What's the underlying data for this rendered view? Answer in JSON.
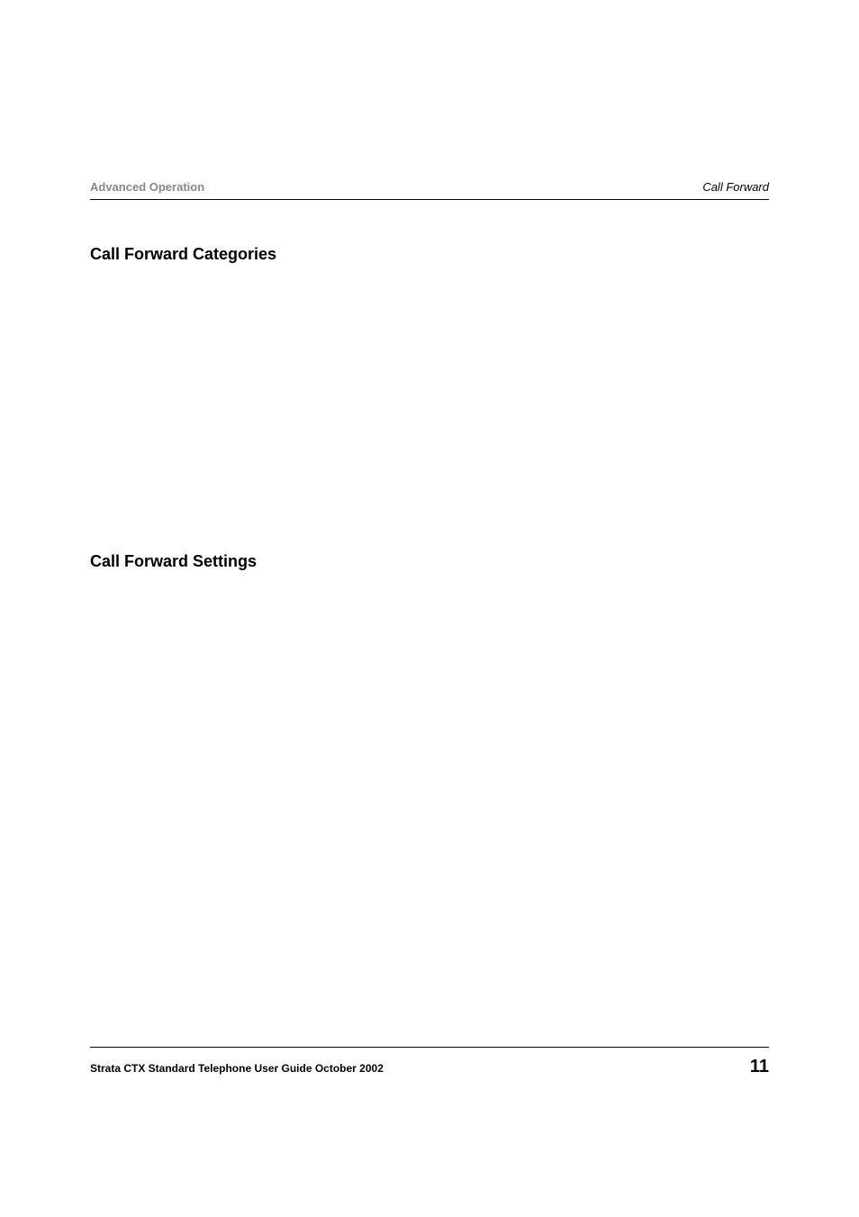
{
  "header": {
    "left": "Advanced Operation",
    "right": "Call Forward"
  },
  "sections": {
    "heading1": "Call Forward Categories",
    "heading2": "Call Forward Settings"
  },
  "footer": {
    "left": "Strata CTX Standard Telephone User Guide  October 2002",
    "pageNumber": "11"
  }
}
